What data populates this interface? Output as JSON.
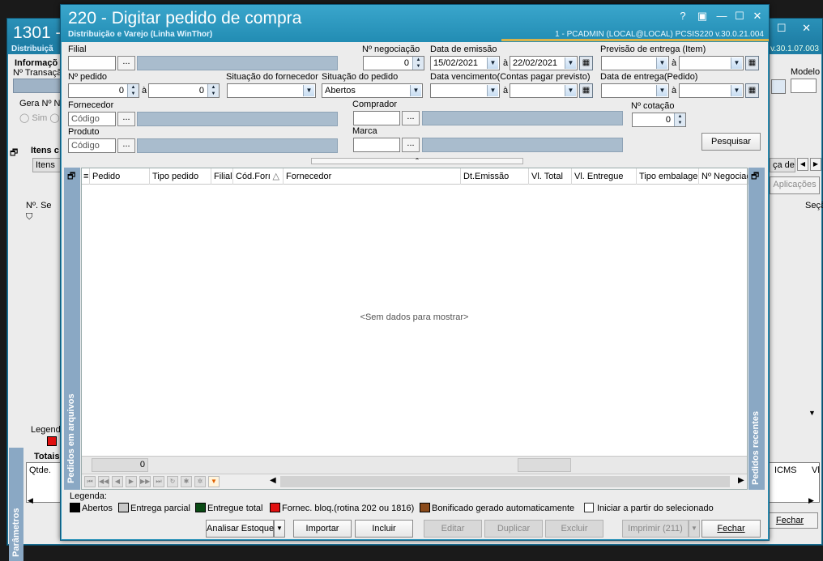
{
  "bg_window": {
    "title": "1301 -",
    "subtitle": "Distribuiçã",
    "version": "v.30.1.07.003",
    "info_label": "Informaçõ",
    "transacao_label": "Nº Transaçã",
    "gera_label": "Gera Nº NF",
    "sim_label": "Sim",
    "modelo_label": "Modelo",
    "itens_label": "Itens c",
    "itens_tab": "Itens",
    "n_se_label": "Nº. Se",
    "ca_de_tab": "ça de",
    "aplicacoes_btn": "Aplicações",
    "seca_col": "Seçã",
    "legend_label": "Legenda",
    "totais_label": "Totais",
    "qtde_label": "Qtde.",
    "icms_label": "ICMS",
    "vl_label": "Vl",
    "fechar_btn": "Fechar",
    "parametros_panel": "Parâmetros"
  },
  "window": {
    "title": "220 - Digitar pedido de compra",
    "subtitle": "Distribuição e Varejo (Linha WinThor)",
    "user_info": "1 - PCADMIN (LOCAL@LOCAL)   PCSIS220  v.30.0.21.004",
    "controls": [
      "?",
      "▣",
      "—",
      "☐",
      "✕"
    ]
  },
  "filters": {
    "filial_label": "Filial",
    "filial_value": "",
    "negociacao_label": "Nº negociação",
    "negociacao_value": "0",
    "data_emissao_label": "Data de emissão",
    "data_emissao_from": "15/02/2021",
    "data_emissao_to": "22/02/2021",
    "previsao_label": "Previsão  de entrega (Item)",
    "pedido_label": "Nº pedido",
    "pedido_from": "0",
    "pedido_to": "0",
    "sit_fornecedor_label": "Situação do fornecedor",
    "sit_pedido_label": "Situação do pedido",
    "sit_pedido_value": "Abertos",
    "vencimento_label": "Data vencimento(Contas pagar previsto)",
    "entrega_pedido_label": "Data de entrega(Pedido)",
    "fornecedor_label": "Fornecedor",
    "fornecedor_placeholder": "Código",
    "comprador_label": "Comprador",
    "cotacao_label": "Nº cotação",
    "cotacao_value": "0",
    "produto_label": "Produto",
    "produto_placeholder": "Código",
    "marca_label": "Marca",
    "ate": "à",
    "dots": "...",
    "pesquisar_btn": "Pesquisar"
  },
  "grid": {
    "columns": [
      "Pedido",
      "Tipo pedido",
      "Filial",
      "Cód.Forı",
      "Fornecedor",
      "Dt.Emissão",
      "Vl. Total",
      "Vl. Entregue",
      "Tipo embalager",
      "Nº Negociaç"
    ],
    "sort_indicator": "△",
    "empty_text": "<Sem dados para mostrar>",
    "footer_count": "0",
    "left_panel": "Pedidos em arquivos",
    "right_panel": "Pedidos recentes"
  },
  "legend": {
    "title": "Legenda:",
    "items": [
      {
        "label": "Abertos",
        "color": "#000000"
      },
      {
        "label": "Entrega parcial",
        "color": "#c8c8c8"
      },
      {
        "label": "Entregue total",
        "color": "#0a4a14"
      },
      {
        "label": "Fornec. bloq.(rotina 202 ou 1816)",
        "color": "#e01010"
      },
      {
        "label": "Bonificado gerado automaticamente",
        "color": "#8a4a1a"
      }
    ],
    "iniciar_label": "Iniciar a partir do selecionado"
  },
  "actions": {
    "analisar": "Analisar Estoque",
    "importar": "Importar",
    "incluir": "Incluir",
    "editar": "Editar",
    "duplicar": "Duplicar",
    "excluir": "Excluir",
    "imprimir": "Imprimir (211)",
    "fechar": "Fechar"
  }
}
